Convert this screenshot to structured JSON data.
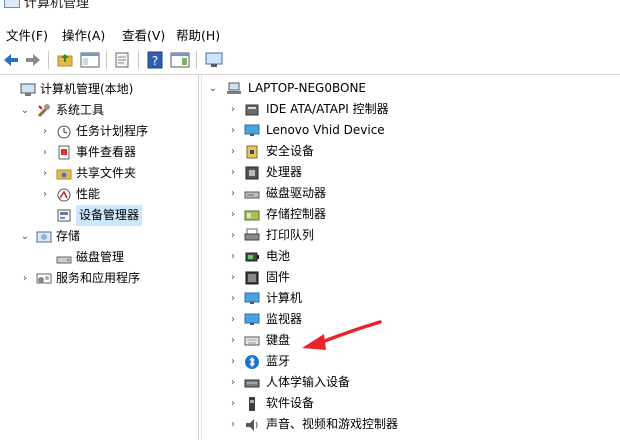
{
  "window": {
    "title": "计算机管理"
  },
  "menu": [
    {
      "label": "文件(F)"
    },
    {
      "label": "操作(A)"
    },
    {
      "label": "查看(V)"
    },
    {
      "label": "帮助(H)"
    }
  ],
  "left_tree": [
    {
      "label": "计算机管理(本地)",
      "icon": "computer-management-icon",
      "expand": "",
      "level": 0
    },
    {
      "label": "系统工具",
      "icon": "tools-icon",
      "expand": "expanded",
      "level": 1
    },
    {
      "label": "任务计划程序",
      "icon": "clock-icon",
      "expand": "collapsed",
      "level": 2
    },
    {
      "label": "事件查看器",
      "icon": "event-viewer-icon",
      "expand": "collapsed",
      "level": 2
    },
    {
      "label": "共享文件夹",
      "icon": "shared-folder-icon",
      "expand": "collapsed",
      "level": 2
    },
    {
      "label": "性能",
      "icon": "performance-icon",
      "expand": "collapsed",
      "level": 2
    },
    {
      "label": "设备管理器",
      "icon": "device-manager-icon",
      "expand": "",
      "level": 2,
      "selected": true
    },
    {
      "label": "存储",
      "icon": "storage-icon",
      "expand": "expanded",
      "level": 1
    },
    {
      "label": "磁盘管理",
      "icon": "disk-management-icon",
      "expand": "",
      "level": 2
    },
    {
      "label": "服务和应用程序",
      "icon": "services-icon",
      "expand": "collapsed",
      "level": 1
    }
  ],
  "device_tree": {
    "root": "LAPTOP-NEG0BONE",
    "items": [
      {
        "label": "IDE ATA/ATAPI 控制器",
        "icon": "ide-controller-icon"
      },
      {
        "label": "Lenovo Vhid Device",
        "icon": "monitor-icon"
      },
      {
        "label": "安全设备",
        "icon": "security-device-icon"
      },
      {
        "label": "处理器",
        "icon": "processor-icon"
      },
      {
        "label": "磁盘驱动器",
        "icon": "disk-drive-icon"
      },
      {
        "label": "存储控制器",
        "icon": "storage-controller-icon"
      },
      {
        "label": "打印队列",
        "icon": "printer-icon"
      },
      {
        "label": "电池",
        "icon": "battery-icon"
      },
      {
        "label": "固件",
        "icon": "firmware-icon"
      },
      {
        "label": "计算机",
        "icon": "monitor-icon"
      },
      {
        "label": "监视器",
        "icon": "monitor-icon"
      },
      {
        "label": "键盘",
        "icon": "keyboard-icon"
      },
      {
        "label": "蓝牙",
        "icon": "bluetooth-icon"
      },
      {
        "label": "人体学输入设备",
        "icon": "hid-icon"
      },
      {
        "label": "软件设备",
        "icon": "software-device-icon"
      },
      {
        "label": "声音、视频和游戏控制器",
        "icon": "speaker-icon"
      }
    ]
  },
  "colors": {
    "selection": "#cce8ff",
    "arrow": "#e8232a",
    "accent": "#1a73c9"
  }
}
